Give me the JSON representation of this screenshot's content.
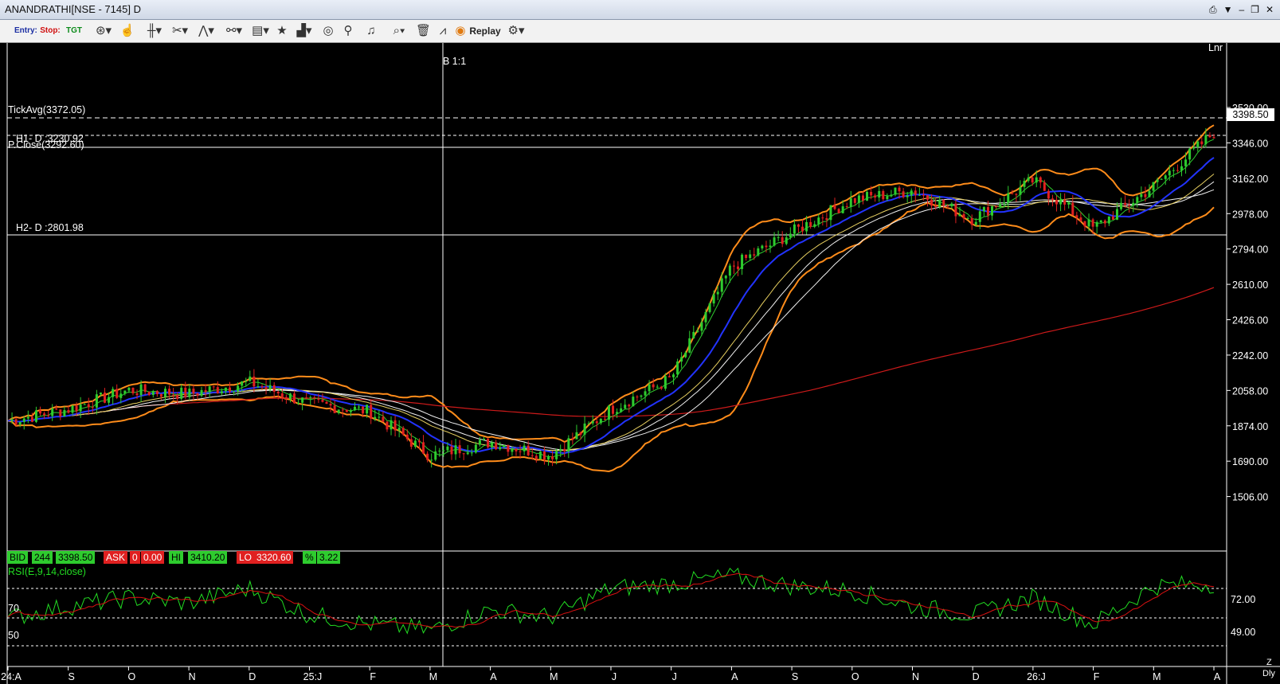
{
  "window": {
    "title": "ANANDRATHI[NSE - 7145] D",
    "controls": [
      "⎙",
      "▼",
      "–",
      "❐",
      "✕"
    ]
  },
  "toolbar": {
    "entry": "Entry:",
    "stop": "Stop:",
    "tgt": "TGT",
    "replay": "Replay"
  },
  "chart": {
    "scale_mode": "Lnr",
    "crosshair_label": "B 1:1",
    "tick_avg": "TickAvg(3372.05)",
    "h1_label": "H1- D :3230.92",
    "p_close": "P.Close(3292.60)",
    "h2_label": "H2- D :2801.98",
    "last_price": "3398.50"
  },
  "quote_bar": {
    "bid_label": "BID",
    "bid_qty": "244",
    "bid_price": "3398.50",
    "ask_label": "ASK",
    "ask_qty": "0",
    "ask_price": "0.00",
    "hi_label": "HI",
    "hi_value": "3410.20",
    "lo_label": "LO",
    "lo_value": "3320.60",
    "pct_label": "%",
    "pct_value": "3.22"
  },
  "rsi": {
    "title": "RSI(E,9,14,close)",
    "left_levels": [
      "70",
      "50"
    ],
    "right_levels": [
      "72.00",
      "49.00"
    ],
    "corner": "Z",
    "corner2": "Dly"
  },
  "colors": {
    "up": "#2ecc2e",
    "down": "#e02020",
    "bollinger": "#ff8c1a",
    "ema_blue": "#2233ff",
    "sma_red": "#cc1a1a",
    "ma_white": "#f0f0f0",
    "ma_yellow": "#e8d060",
    "rsi": "#22dd22",
    "rsi_signal": "#dd1111"
  },
  "chart_data": {
    "type": "candlestick",
    "y_axis_ticks": [
      "3530.00",
      "3346.00",
      "3162.00",
      "2978.00",
      "2794.00",
      "2610.00",
      "2426.00",
      "2242.00",
      "2058.00",
      "1874.00",
      "1690.00",
      "1506.00"
    ],
    "ylim": [
      1380,
      3700
    ],
    "x_axis_labels": [
      "24:A",
      "S",
      "O",
      "N",
      "D",
      "25:J",
      "F",
      "M",
      "A",
      "M",
      "J",
      "J",
      "A",
      "S",
      "O",
      "N",
      "D",
      "26:J",
      "F",
      "M",
      "A"
    ],
    "approx_close_path": [
      [
        0,
        1900
      ],
      [
        1,
        1960
      ],
      [
        2,
        2060
      ],
      [
        3,
        2040
      ],
      [
        4,
        2100
      ],
      [
        5,
        1990
      ],
      [
        6,
        1950
      ],
      [
        7,
        1720
      ],
      [
        8,
        1790
      ],
      [
        9,
        1720
      ],
      [
        10,
        1960
      ],
      [
        11,
        2120
      ],
      [
        12,
        2700
      ],
      [
        13,
        2880
      ],
      [
        14,
        3050
      ],
      [
        15,
        3100
      ],
      [
        16,
        2950
      ],
      [
        17,
        3150
      ],
      [
        18,
        2900
      ],
      [
        19,
        3120
      ],
      [
        20,
        3398.5
      ]
    ],
    "series": [
      {
        "name": "RSI(E,9,14,close)",
        "approx_values": [
          45,
          55,
          62,
          58,
          70,
          48,
          40,
          35,
          52,
          46,
          70,
          74,
          80,
          72,
          68,
          55,
          48,
          62,
          40,
          72,
          74
        ]
      }
    ]
  }
}
